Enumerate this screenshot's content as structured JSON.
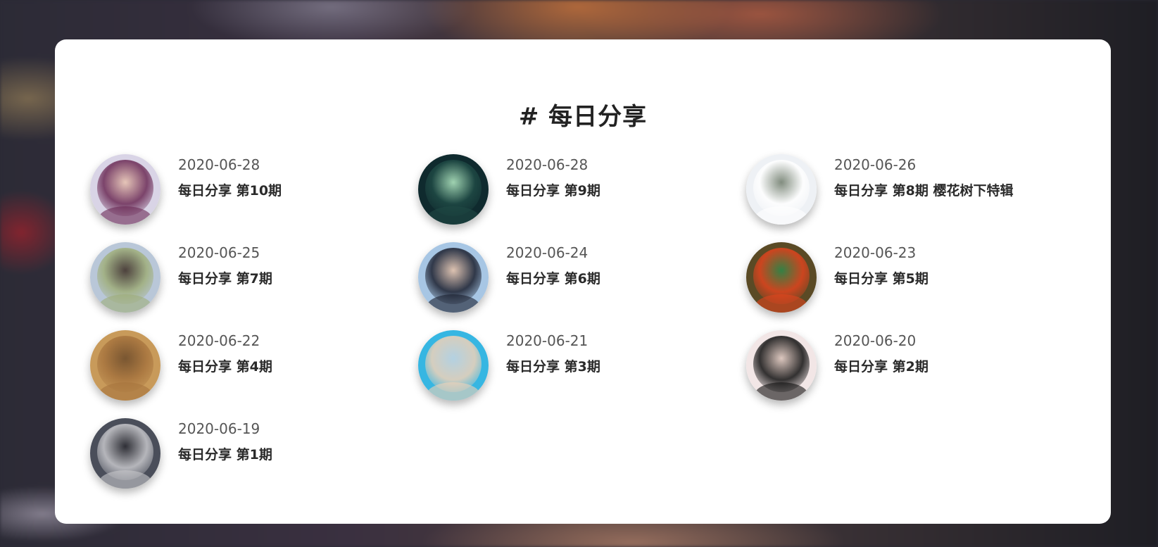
{
  "page": {
    "title": "# 每日分享"
  },
  "items": [
    {
      "date": "2020-06-28",
      "title": "每日分享 第10期",
      "image": "portrait-woman-purple-hair",
      "colors": [
        "#d9d4e6",
        "#6b2a55",
        "#e8c3b0"
      ]
    },
    {
      "date": "2020-06-28",
      "title": "每日分享 第9期",
      "image": "forest-fireflies",
      "colors": [
        "#0f2a2e",
        "#1f4a45",
        "#b9f0c8"
      ]
    },
    {
      "date": "2020-06-26",
      "title": "每日分享 第8期 樱花树下特辑",
      "image": "white-blossoms",
      "colors": [
        "#eef1f5",
        "#ffffff",
        "#6e7b6a"
      ]
    },
    {
      "date": "2020-06-25",
      "title": "每日分享 第7期",
      "image": "woman-meadow",
      "colors": [
        "#b9c7d8",
        "#9fae7a",
        "#3a2a22"
      ]
    },
    {
      "date": "2020-06-24",
      "title": "每日分享 第6期",
      "image": "portrait-man-suit",
      "colors": [
        "#a7c6e4",
        "#1b1f2e",
        "#e7c2a8"
      ]
    },
    {
      "date": "2020-06-23",
      "title": "每日分享 第5期",
      "image": "red-flowers-bird",
      "colors": [
        "#5a4a25",
        "#e0441e",
        "#2d8a4a"
      ]
    },
    {
      "date": "2020-06-22",
      "title": "每日分享 第4期",
      "image": "deer-grassland",
      "colors": [
        "#c89a5a",
        "#a7743e",
        "#6b4a2a"
      ]
    },
    {
      "date": "2020-06-21",
      "title": "每日分享 第3期",
      "image": "portrait-man-glasses-blue",
      "colors": [
        "#36b6e2",
        "#f1d2b8",
        "#c9d6e2"
      ]
    },
    {
      "date": "2020-06-20",
      "title": "每日分享 第2期",
      "image": "portrait-black-white",
      "colors": [
        "#f2e6e6",
        "#111111",
        "#d9c2b8"
      ]
    },
    {
      "date": "2020-06-19",
      "title": "每日分享 第1期",
      "image": "costume-figure-gray",
      "colors": [
        "#4a4e5a",
        "#c8c8cc",
        "#2a2a30"
      ]
    }
  ]
}
